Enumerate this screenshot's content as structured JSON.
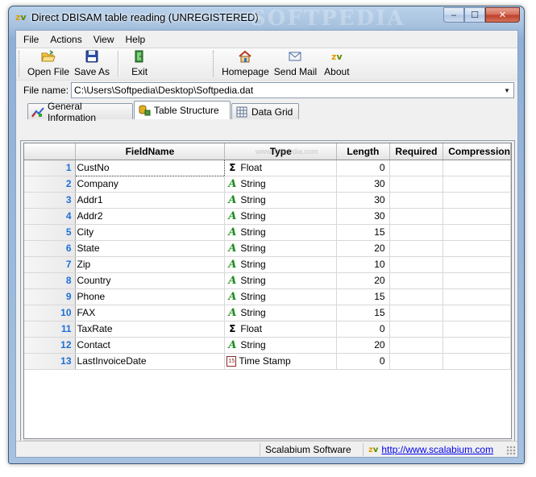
{
  "window": {
    "title": "Direct DBISAM table reading (UNREGISTERED)",
    "watermark": "SOFTPEDIA",
    "controls": {
      "minimize": "‒",
      "maximize": "☐",
      "close": "✕"
    }
  },
  "menu": {
    "items": [
      "File",
      "Actions",
      "View",
      "Help"
    ]
  },
  "toolbar": {
    "buttons": [
      {
        "label": "Open File",
        "icon": "open-folder-icon"
      },
      {
        "label": "Save As",
        "icon": "floppy-disk-icon"
      },
      {
        "label": "Exit",
        "icon": "exit-door-icon"
      },
      {
        "label": "Homepage",
        "icon": "home-icon"
      },
      {
        "label": "Send Mail",
        "icon": "envelope-icon"
      },
      {
        "label": "About",
        "icon": "about-logo-icon"
      }
    ]
  },
  "filebar": {
    "label": "File name:",
    "value": "C:\\Users\\Softpedia\\Desktop\\Softpedia.dat"
  },
  "tabs": [
    {
      "label": "General Information",
      "icon": "info-chart-icon",
      "active": false
    },
    {
      "label": "Table Structure",
      "icon": "table-structure-icon",
      "active": true
    },
    {
      "label": "Data Grid",
      "icon": "data-grid-icon",
      "active": false
    }
  ],
  "grid": {
    "columns": [
      "FieldName",
      "Type",
      "Length",
      "Required",
      "Compression"
    ],
    "rows": [
      {
        "n": "1",
        "name": "CustNo",
        "type": "Float",
        "length": "0"
      },
      {
        "n": "2",
        "name": "Company",
        "type": "String",
        "length": "30"
      },
      {
        "n": "3",
        "name": "Addr1",
        "type": "String",
        "length": "30"
      },
      {
        "n": "4",
        "name": "Addr2",
        "type": "String",
        "length": "30"
      },
      {
        "n": "5",
        "name": "City",
        "type": "String",
        "length": "15"
      },
      {
        "n": "6",
        "name": "State",
        "type": "String",
        "length": "20"
      },
      {
        "n": "7",
        "name": "Zip",
        "type": "String",
        "length": "10"
      },
      {
        "n": "8",
        "name": "Country",
        "type": "String",
        "length": "20"
      },
      {
        "n": "9",
        "name": "Phone",
        "type": "String",
        "length": "15"
      },
      {
        "n": "10",
        "name": "FAX",
        "type": "String",
        "length": "15"
      },
      {
        "n": "11",
        "name": "TaxRate",
        "type": "Float",
        "length": "0"
      },
      {
        "n": "12",
        "name": "Contact",
        "type": "String",
        "length": "20"
      },
      {
        "n": "13",
        "name": "LastInvoiceDate",
        "type": "Time Stamp",
        "length": "0"
      }
    ],
    "type_icons": {
      "Float": "Σ",
      "String": "A",
      "Time Stamp": "15"
    }
  },
  "statusbar": {
    "company": "Scalabium Software",
    "url": "http://www.scalabium.com"
  }
}
